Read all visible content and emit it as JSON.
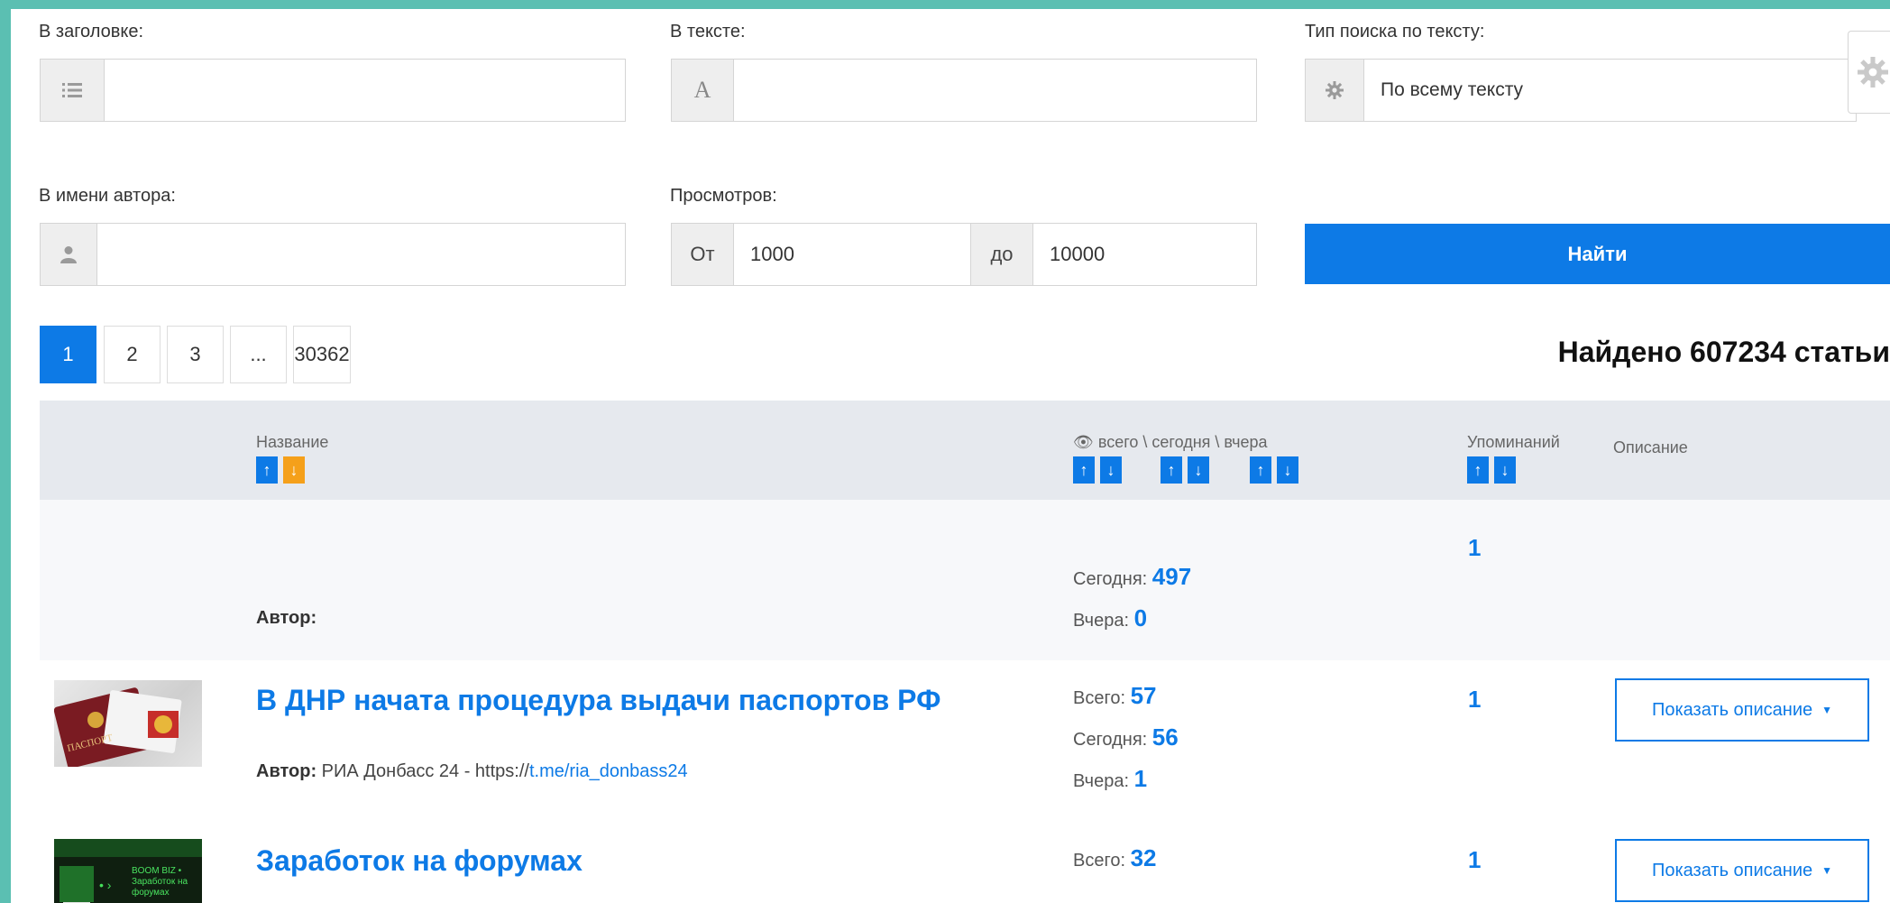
{
  "filters": {
    "title_label": "В заголовке:",
    "title_value": "",
    "text_label": "В тексте:",
    "text_value": "",
    "text_icon": "A",
    "search_type_label": "Тип поиска по тексту:",
    "search_type_value": "По всему тексту",
    "author_label": "В имени автора:",
    "author_value": "",
    "views_label": "Просмотров:",
    "views_from_label": "От",
    "views_from_value": "1000",
    "views_to_label": "до",
    "views_to_value": "10000",
    "search_button": "Найти"
  },
  "pagination": {
    "pages": [
      "1",
      "2",
      "3",
      "...",
      "30362"
    ],
    "active": "1"
  },
  "results_count": "Найдено 607234 статьи",
  "table": {
    "headers": {
      "name": "Название",
      "views": "👁 всего \\ сегодня \\ вчера",
      "mentions": "Упоминаний",
      "description": "Описание"
    },
    "arrows": {
      "up": "↑",
      "down": "↓"
    },
    "rows": [
      {
        "title": "",
        "author_label": "Автор:",
        "author_text": "",
        "author_link": "",
        "stats": [
          {
            "label": "Сегодня:",
            "value": "497"
          },
          {
            "label": "Вчера:",
            "value": "0"
          }
        ],
        "mentions": "1",
        "desc_button": ""
      },
      {
        "title": "В ДНР начата процедура выдачи паспортов РФ",
        "author_label": "Автор:",
        "author_text": "РИА Донбасс 24 - https://",
        "author_link": "t.me/ria_donbass24",
        "stats": [
          {
            "label": "Всего:",
            "value": "57"
          },
          {
            "label": "Сегодня:",
            "value": "56"
          },
          {
            "label": "Вчера:",
            "value": "1"
          }
        ],
        "mentions": "1",
        "desc_button": "Показать описание",
        "thumb_text": "ПАСПОРТ"
      },
      {
        "title": "Заработок на форумах",
        "author_label": "",
        "author_text": "",
        "author_link": "",
        "stats": [
          {
            "label": "Всего:",
            "value": "32"
          }
        ],
        "mentions": "1",
        "desc_button": "Показать описание",
        "thumb_text": "BOOM BIZ • Заработок на форумах"
      }
    ]
  },
  "colors": {
    "accent": "#0d7ae6",
    "sort_active": "#f5a01a",
    "frame": "#5bbfb2"
  }
}
